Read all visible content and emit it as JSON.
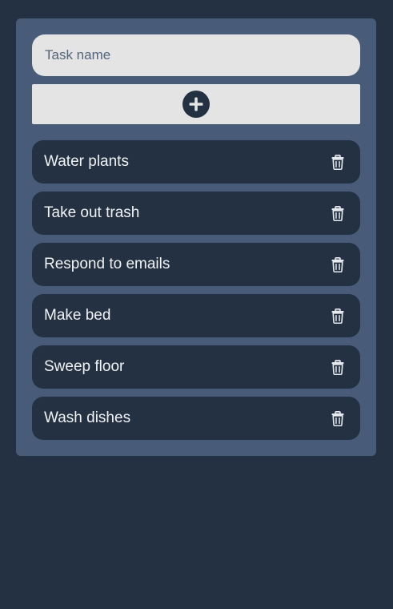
{
  "form": {
    "task_input_placeholder": "Task name",
    "task_input_value": "",
    "add_icon": "plus-circle-icon"
  },
  "tasks": [
    {
      "label": "Water plants",
      "delete_icon": "trash-icon"
    },
    {
      "label": "Take out trash",
      "delete_icon": "trash-icon"
    },
    {
      "label": "Respond to emails",
      "delete_icon": "trash-icon"
    },
    {
      "label": "Make bed",
      "delete_icon": "trash-icon"
    },
    {
      "label": "Sweep floor",
      "delete_icon": "trash-icon"
    },
    {
      "label": "Wash dishes",
      "delete_icon": "trash-icon"
    }
  ],
  "colors": {
    "page_background": "#243142",
    "card_background": "#485c7a",
    "input_background": "#e4e4e4",
    "task_background": "#243142",
    "task_text": "#f0f2f5"
  }
}
